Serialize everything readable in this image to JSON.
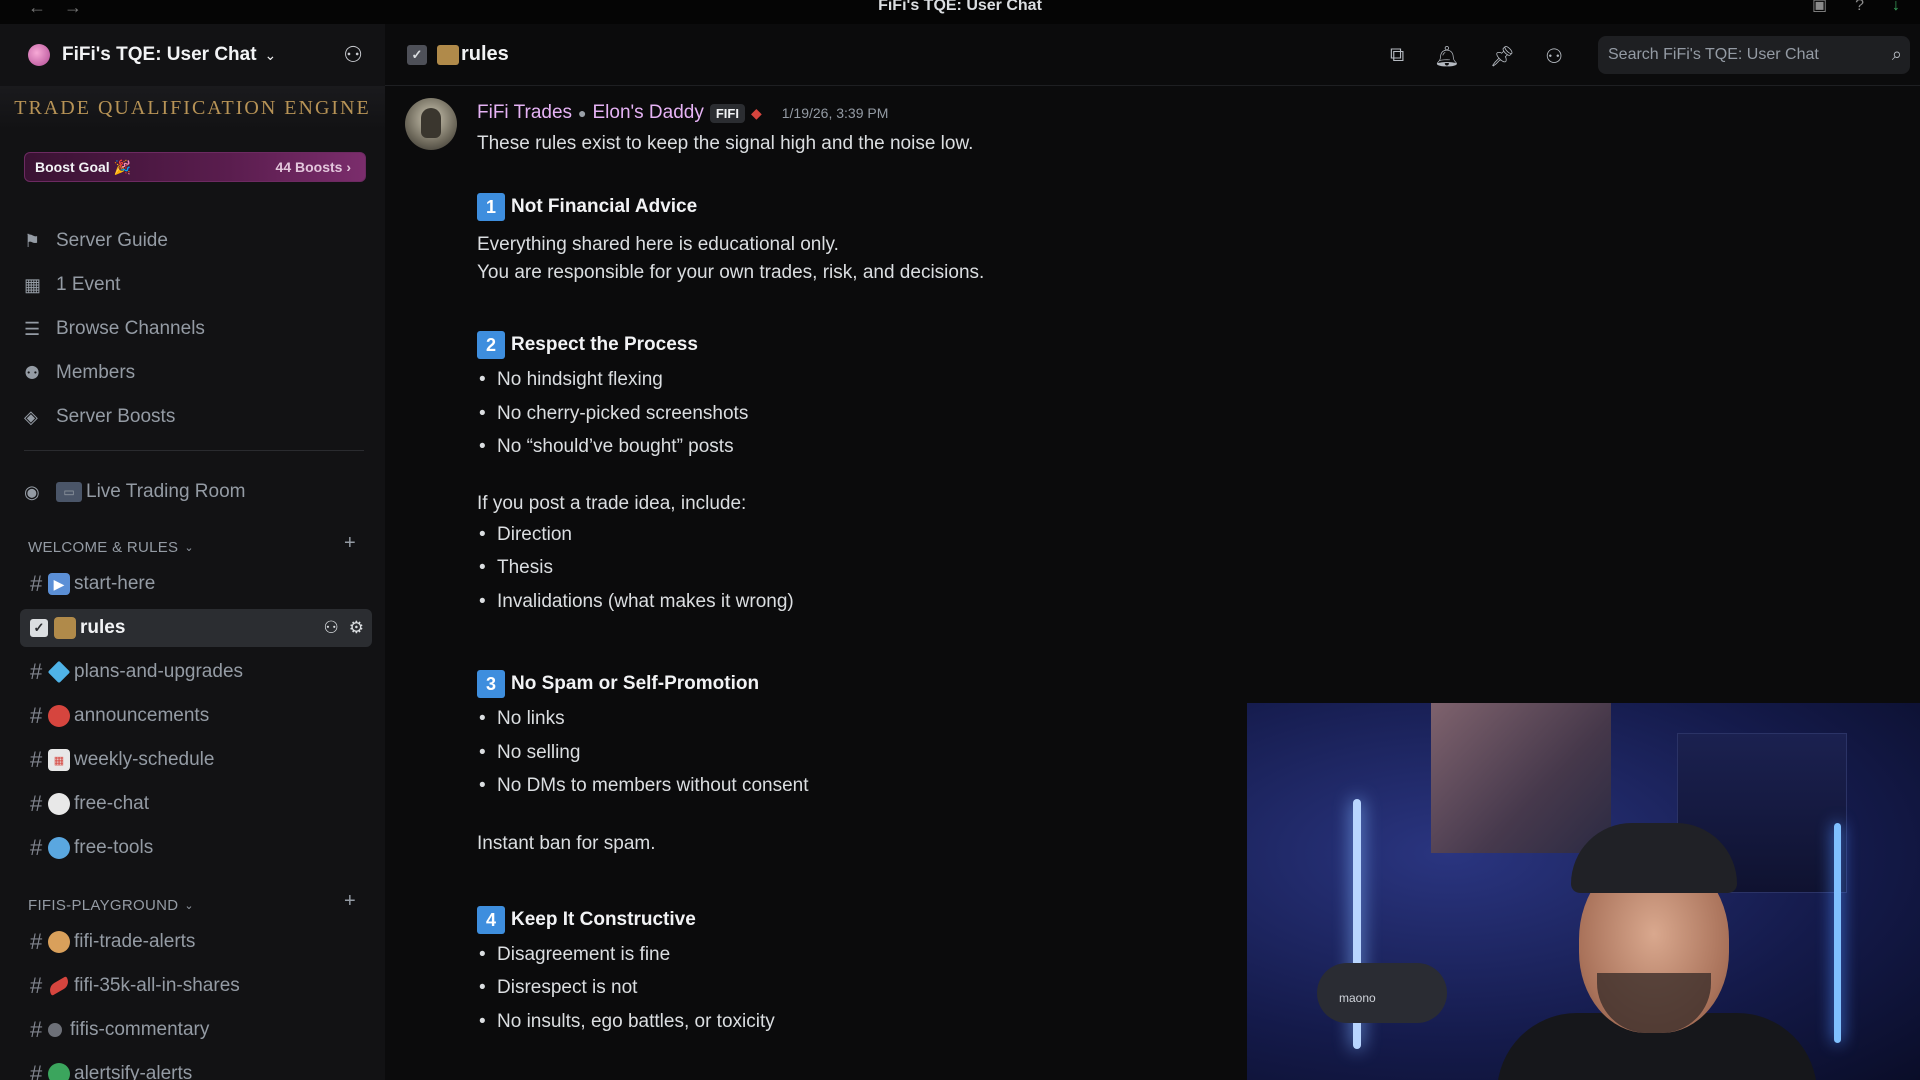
{
  "window": {
    "title": "FiFi's TQE: User Chat",
    "back_glyph": "←",
    "forward_glyph": "→"
  },
  "server": {
    "name": "FiFi's TQE: User Chat",
    "banner_text": "TRADE QUALIFICATION ENGINE",
    "boost_label": "Boost Goal 🎉",
    "boost_count": "44 Boosts ›"
  },
  "sidebar": {
    "nav": [
      {
        "label": "Server Guide",
        "icon": "signpost-icon"
      },
      {
        "label": "1 Event",
        "icon": "calendar-icon"
      },
      {
        "label": "Browse Channels",
        "icon": "browse-icon"
      },
      {
        "label": "Members",
        "icon": "members-icon"
      },
      {
        "label": "Server Boosts",
        "icon": "boost-icon"
      }
    ],
    "live_room": "Live Trading Room",
    "categories": [
      {
        "name": "WELCOME & RULES",
        "channels": [
          "start-here",
          "rules",
          "plans-and-upgrades",
          "announcements",
          "weekly-schedule",
          "free-chat",
          "free-tools"
        ]
      },
      {
        "name": "FIFIS-PLAYGROUND",
        "channels": [
          "fifi-trade-alerts",
          "fifi-35k-all-in-shares",
          "fifis-commentary",
          "alertsify-alerts"
        ]
      }
    ]
  },
  "channel": {
    "name": "rules",
    "search_placeholder": "Search FiFi's TQE: User Chat"
  },
  "message": {
    "author": "FiFi Trades",
    "author_alt": "Elon's Daddy",
    "role_tag": "FIFI",
    "timestamp": "1/19/26, 3:39 PM",
    "intro": "These rules exist to keep the signal high and the noise low.",
    "sections": [
      {
        "number": "1",
        "title": "Not Financial Advice",
        "lines": [
          "Everything shared here is educational only.",
          "You are responsible for your own trades, risk, and decisions."
        ]
      },
      {
        "number": "2",
        "title": "Respect the Process",
        "bullets": [
          "No hindsight flexing",
          "No cherry-picked screenshots",
          "No “should’ve bought” posts"
        ],
        "subtext": "If you post a trade idea, include:",
        "bullets2": [
          "Direction",
          "Thesis",
          "Invalidations (what makes it wrong)"
        ]
      },
      {
        "number": "3",
        "title": "No Spam or Self-Promotion",
        "bullets": [
          "No links",
          "No selling",
          "No DMs to members without consent"
        ],
        "subtext": "Instant ban for spam."
      },
      {
        "number": "4",
        "title": "Keep It Constructive",
        "bullets": [
          "Disagreement is fine",
          "Disrespect is not",
          "No insults, ego battles, or toxicity"
        ]
      }
    ]
  },
  "webcam": {
    "mic_brand": "maono"
  },
  "colors": {
    "accent": "#3e8ede",
    "author": "#e6b3f5",
    "boost_bar": "#5a1d4e",
    "banner_gold": "#b79356"
  }
}
